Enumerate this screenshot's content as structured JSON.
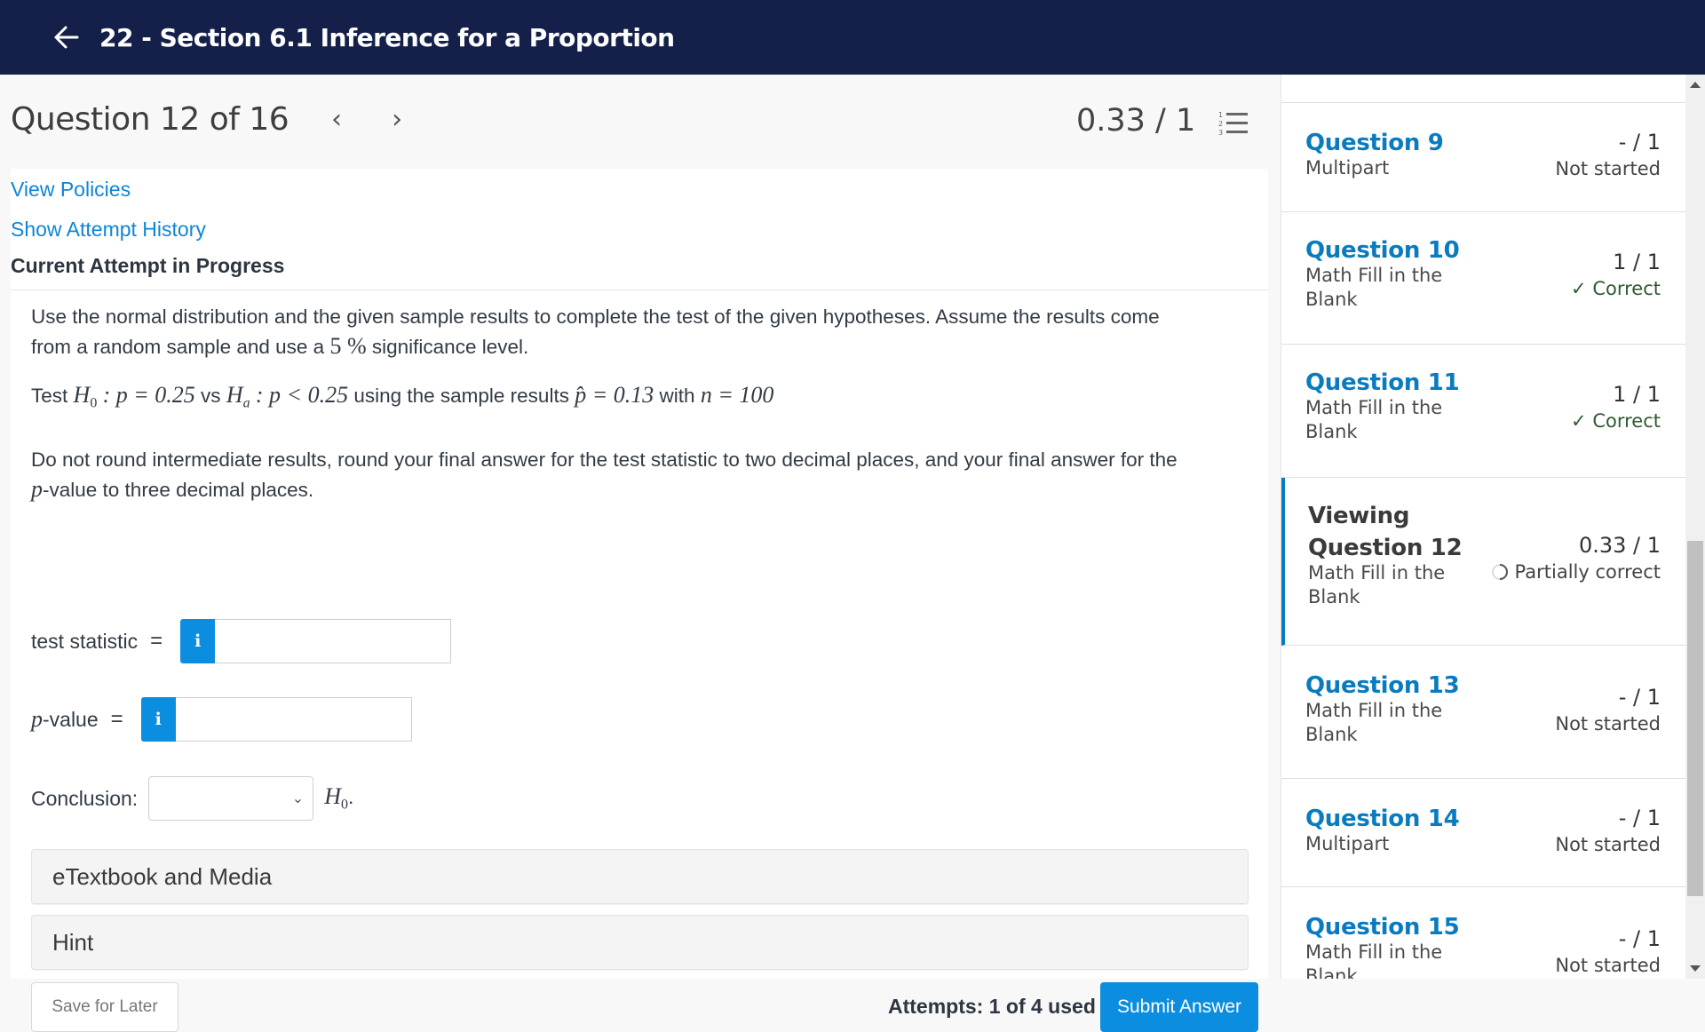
{
  "header": {
    "back_icon": "arrow-left-icon",
    "title": "22 - Section 6.1 Inference for a Proportion"
  },
  "question_nav": {
    "label": "Question 12 of 16",
    "prev_icon": "chevron-left-icon",
    "prev_glyph": "‹",
    "next_icon": "chevron-right-icon",
    "next_glyph": "›",
    "score": "0.33 / 1",
    "list_icon": "numbered-list-icon"
  },
  "links": {
    "view_policies": "View Policies",
    "show_attempt_history": "Show Attempt History"
  },
  "attempt_heading": "Current Attempt in Progress",
  "question": {
    "intro_1": "Use the normal distribution and the given sample results to complete the test of the given hypotheses. Assume the results come",
    "intro_2a": "from a random sample and use a",
    "significance": "5 %",
    "intro_2b": "significance level.",
    "test_word": "Test",
    "h0": "H",
    "h0_sub": "0",
    "h0_expr": ": p = 0.25",
    "vs": "vs",
    "ha": "H",
    "ha_sub": "a",
    "ha_expr": ": p < 0.25",
    "using": "using the sample results",
    "phat": "p̂ = 0.13",
    "with": "with",
    "n_expr": "n = 100",
    "instr_1": "Do not round intermediate results, round your final answer for the test statistic to two decimal places, and your final answer for the",
    "instr_2_var": "p",
    "instr_2": "-value to three decimal places."
  },
  "fields": {
    "test_statistic_label": "test statistic",
    "p_label_var": "p",
    "p_label": "-value",
    "equals": "=",
    "info_glyph": "i",
    "test_statistic_value": "",
    "p_value_value": "",
    "conclusion_label": "Conclusion:",
    "conclusion_selected": "",
    "conclusion_suffix_var": "H",
    "conclusion_suffix_sub": "0",
    "conclusion_suffix_end": "."
  },
  "accordions": [
    {
      "label": "eTextbook and Media"
    },
    {
      "label": "Hint"
    }
  ],
  "footer": {
    "save_label": "Save for Later",
    "attempts": "Attempts: 1 of 4 used",
    "submit_label": "Submit Answer"
  },
  "sidebar": {
    "items": [
      {
        "title": "Question 9",
        "type": "Multipart",
        "score": "- / 1",
        "status": "Not started",
        "status_kind": "none",
        "active": false
      },
      {
        "title": "Question 10",
        "type": "Math Fill in the Blank",
        "score": "1 / 1",
        "status": "Correct",
        "status_kind": "correct",
        "active": false
      },
      {
        "title": "Question 11",
        "type": "Math Fill in the Blank",
        "score": "1 / 1",
        "status": "Correct",
        "status_kind": "correct",
        "active": false
      },
      {
        "title_prefix": "Viewing",
        "title": "Question 12",
        "type": "Math Fill in the Blank",
        "score": "0.33 / 1",
        "status": "Partially correct",
        "status_kind": "partial",
        "active": true
      },
      {
        "title": "Question 13",
        "type": "Math Fill in the Blank",
        "score": "- / 1",
        "status": "Not started",
        "status_kind": "none",
        "active": false
      },
      {
        "title": "Question 14",
        "type": "Multipart",
        "score": "- / 1",
        "status": "Not started",
        "status_kind": "none",
        "active": false
      },
      {
        "title": "Question 15",
        "type": "Math Fill in the Blank",
        "score": "- / 1",
        "status": "Not started",
        "status_kind": "none",
        "active": false
      }
    ]
  },
  "colors": {
    "header_bg": "#14204a",
    "link": "#0c86d6",
    "primary_button": "#0b8ee0",
    "sidebar_title": "#0a7bbf",
    "correct": "#2e5b32"
  }
}
